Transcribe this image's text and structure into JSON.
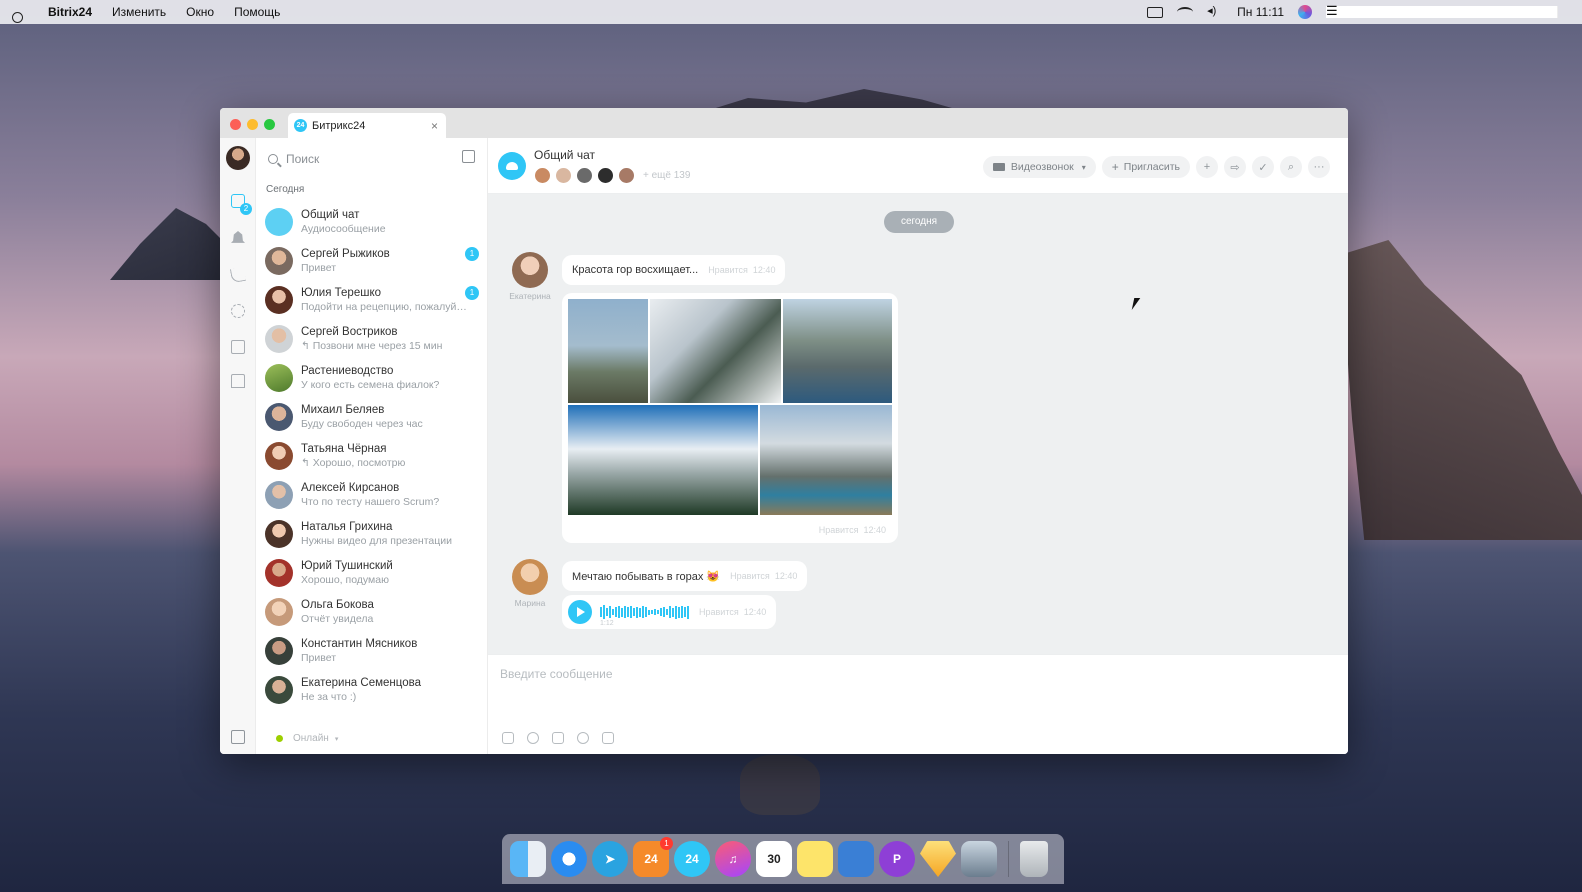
{
  "menubar": {
    "app_name": "Bitrix24",
    "items": [
      "Изменить",
      "Окно",
      "Помощь"
    ],
    "clock": "Пн 11:11"
  },
  "window": {
    "tab_title": "Битрикс24",
    "tab_badge": "24"
  },
  "sidebar": {
    "chat_badge": "2"
  },
  "chat_list": {
    "search_placeholder": "Поиск",
    "section_label": "Сегодня",
    "items": [
      {
        "name": "Общий чат",
        "last": "Аудиосообщение",
        "unread": ""
      },
      {
        "name": "Сергей Рыжиков",
        "last": "Привет",
        "unread": "1"
      },
      {
        "name": "Юлия Терешко",
        "last": "Подойти на рецепцию, пожалуйста",
        "unread": "1"
      },
      {
        "name": "Сергей Вострикoв",
        "last": "↰ Позвони мне через 15 мин",
        "unread": ""
      },
      {
        "name": "Растениеводство",
        "last": "У кого есть семена фиалок?",
        "unread": ""
      },
      {
        "name": "Михаил Беляев",
        "last": "Буду свободен через час",
        "unread": ""
      },
      {
        "name": "Татьяна Чёрная",
        "last": "↰ Хорошо, посмотрю",
        "unread": ""
      },
      {
        "name": "Алексей Кирсанов",
        "last": "Что по тесту нашего Scrum?",
        "unread": ""
      },
      {
        "name": "Наталья Грихина",
        "last": "Нужны видео для презентации",
        "unread": ""
      },
      {
        "name": "Юрий Тушинский",
        "last": "Хорошо, подумаю",
        "unread": ""
      },
      {
        "name": "Ольга Бокова",
        "last": "Отчёт увидела",
        "unread": ""
      },
      {
        "name": "Константин Мясников",
        "last": "Привет",
        "unread": ""
      },
      {
        "name": "Екатерина Семенцова",
        "last": "Не за что :)",
        "unread": ""
      }
    ],
    "status_label": "Онлайн"
  },
  "chat": {
    "title": "Общий чат",
    "members_more": "+ ещё 139",
    "video_call_label": "Видеозвонок",
    "invite_label": "Пригласить",
    "date_label": "сегодня",
    "messages": [
      {
        "author": "Екатерина",
        "text": "Красота гор восхищает...",
        "like": "Нравится",
        "time": "12:40"
      },
      {
        "author": "Екатерина",
        "text": "",
        "like": "Нравится",
        "time": "12:40"
      },
      {
        "author": "Марина",
        "text": "Мечтаю побывать в горах 😻",
        "like": "Нравится",
        "time": "12:40"
      },
      {
        "author": "Марина",
        "text": "",
        "duration": "1:12",
        "like": "Нравится",
        "time": "12:40"
      }
    ],
    "composer_placeholder": "Введите сообщение"
  },
  "dock": {
    "bitrix_badge": "1",
    "calendar_day": "30"
  },
  "colors": {
    "accent": "#2fc6f6",
    "online": "#9dcf00"
  }
}
